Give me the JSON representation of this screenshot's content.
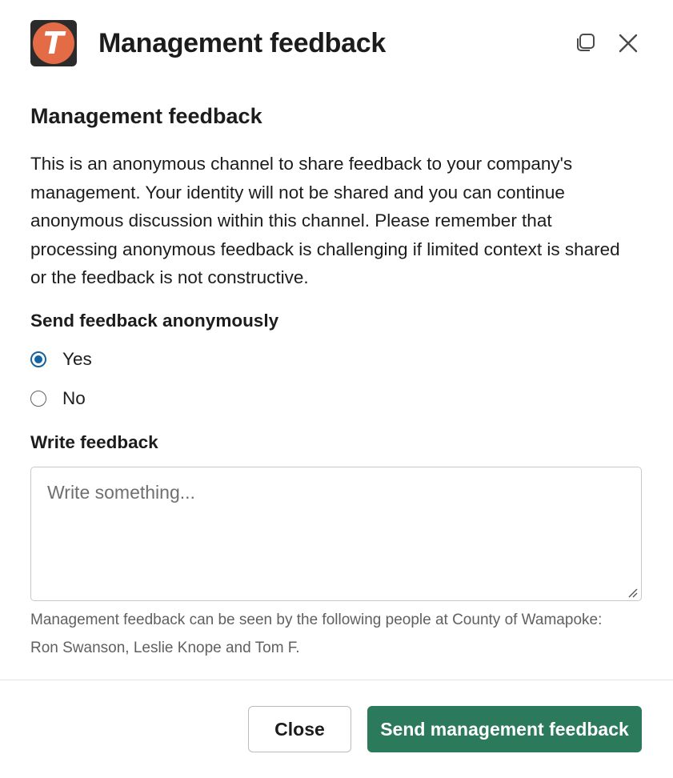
{
  "header": {
    "app_icon_letter": "T",
    "title": "Management feedback",
    "expand_icon": "copy-icon",
    "close_icon": "close-icon"
  },
  "content": {
    "section_title": "Management feedback",
    "description": "This is an anonymous channel to share feedback to your company's management. Your identity will not be shared and you can continue anonymous discussion within this channel. Please remember that processing anonymous feedback is challenging if limited context is shared or the feedback is not constructive.",
    "anonymous_label": "Send feedback anonymously",
    "options": [
      {
        "label": "Yes",
        "checked": true
      },
      {
        "label": "No",
        "checked": false
      }
    ],
    "feedback_label": "Write feedback",
    "feedback_placeholder": "Write something...",
    "feedback_value": "",
    "help_text": "Management feedback can be seen by the following people at County of Wamapoke: Ron Swanson, Leslie Knope and Tom F."
  },
  "footer": {
    "close_label": "Close",
    "send_label": "Send management feedback"
  },
  "colors": {
    "accent": "#1264a3",
    "primary_button": "#2b7a5b",
    "app_icon": "#e36b45"
  }
}
